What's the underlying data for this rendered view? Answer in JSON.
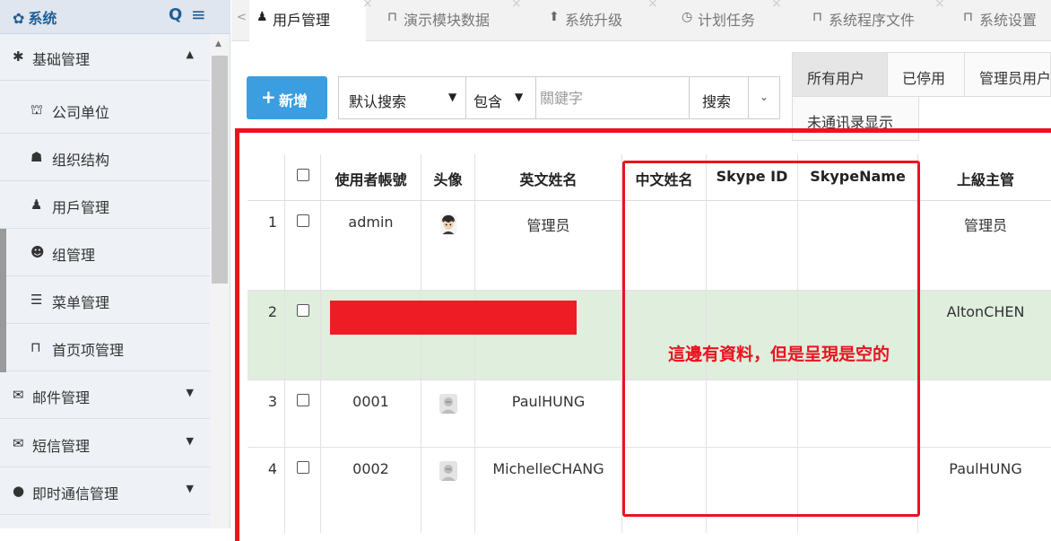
{
  "sidebar": {
    "title": "系统",
    "title_icon": "gear-icon",
    "items": [
      {
        "label": "基础管理",
        "icon": "asterisk-icon",
        "caret": "▲"
      },
      {
        "label": "公司单位",
        "icon": "bank-icon"
      },
      {
        "label": "组织结构",
        "icon": "sitemap-icon"
      },
      {
        "label": "用戶管理",
        "icon": "user-icon"
      },
      {
        "label": "组管理",
        "icon": "group-icon"
      },
      {
        "label": "菜单管理",
        "icon": "list-icon"
      },
      {
        "label": "首页项管理",
        "icon": "bookmark-icon"
      },
      {
        "label": "邮件管理",
        "icon": "envelope-icon",
        "caret": "▼"
      },
      {
        "label": "短信管理",
        "icon": "envelope-outline-icon",
        "caret": "▼"
      },
      {
        "label": "即时通信管理",
        "icon": "chat-icon",
        "caret": "▼"
      }
    ]
  },
  "tabs": [
    {
      "label": "用戶管理",
      "icon": "user-icon",
      "active": true
    },
    {
      "label": "演示模块数据",
      "icon": "bookmark-icon"
    },
    {
      "label": "系统升级",
      "icon": "arrow-up-icon"
    },
    {
      "label": "计划任务",
      "icon": "clock-icon"
    },
    {
      "label": "系统程序文件",
      "icon": "bookmark-icon"
    },
    {
      "label": "系统设置",
      "icon": "bookmark-icon"
    }
  ],
  "toolbar": {
    "add_label": "新增",
    "search_mode": "默认搜索",
    "search_op": "包含",
    "keyword_placeholder": "關鍵字",
    "search_label": "搜索"
  },
  "filters": [
    "所有用户",
    "已停用",
    "管理员用户",
    "未通讯录显示"
  ],
  "table": {
    "columns": [
      "",
      "",
      "使用者帳號",
      "头像",
      "英文姓名",
      "中文姓名",
      "Skype ID",
      "SkypeName",
      "上級主管"
    ],
    "rows": [
      {
        "no": "1",
        "account": "admin",
        "avatar": "photo",
        "english_name": "管理员",
        "chinese_name": "",
        "skype_id": "",
        "skype_name": "",
        "supervisor": "管理员"
      },
      {
        "no": "2",
        "account": "",
        "avatar": "",
        "english_name": "",
        "chinese_name": "",
        "skype_id": "",
        "skype_name": "",
        "supervisor": "AltonCHEN"
      },
      {
        "no": "3",
        "account": "0001",
        "avatar": "placeholder",
        "english_name": "PaulHUNG",
        "chinese_name": "",
        "skype_id": "",
        "skype_name": "",
        "supervisor": ""
      },
      {
        "no": "4",
        "account": "0002",
        "avatar": "placeholder",
        "english_name": "MichelleCHANG",
        "chinese_name": "",
        "skype_id": "",
        "skype_name": "",
        "supervisor": "PaulHUNG"
      }
    ]
  },
  "annotation": "這邊有資料，但是呈現是空的",
  "colors": {
    "accent": "#3a9ee0",
    "highlight": "#e8141f",
    "selected_row": "#dfeedd"
  }
}
